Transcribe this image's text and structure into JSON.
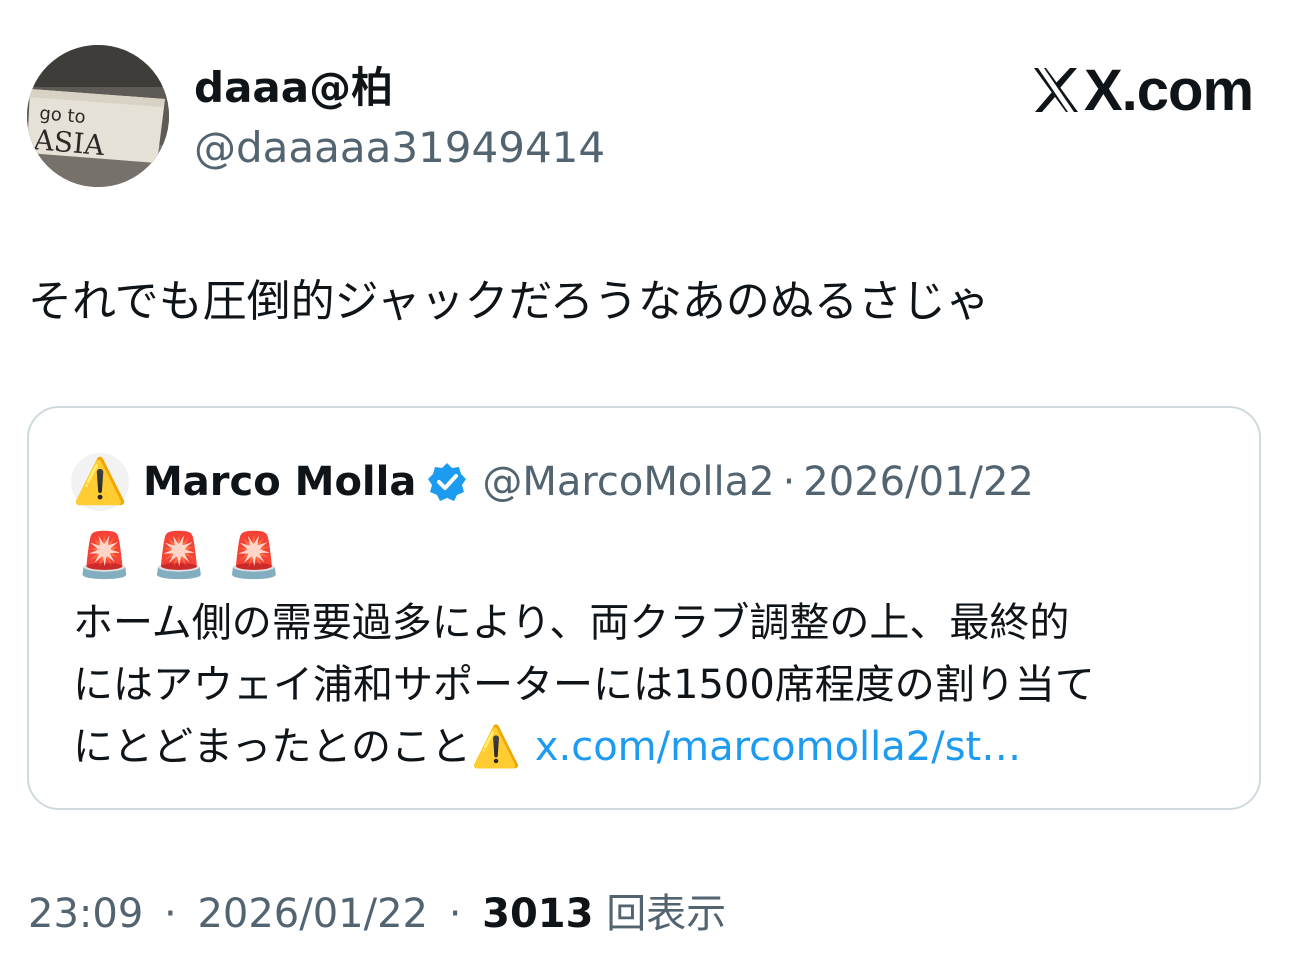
{
  "post": {
    "display_name": "daaa@柏",
    "handle": "@daaaaa31949414",
    "brand": "X.com",
    "avatar_icon": "sign-photo-avatar",
    "avatar_text": "go to ASIA",
    "text": "それでも圧倒的ジャックだろうなあのぬるさじゃ"
  },
  "quote": {
    "author": "Marco Molla",
    "avatar_icon": "warning-icon",
    "verified_icon": "verified-badge-icon",
    "handle": "@MarcoMolla2",
    "separator": "·",
    "date": "2026/01/22",
    "sirens": [
      "🚨",
      "🚨",
      "🚨"
    ],
    "line1": "ホーム側の需要過多により、両クラブ調整の上、最終的",
    "line2": "にはアウェイ浦和サポーターには1500席程度の割り当て",
    "line3": "にとどまったとのこと⚠️",
    "link": "x.com/marcomolla2/st…"
  },
  "meta": {
    "time": "23:09",
    "separator": "·",
    "date": "2026/01/22",
    "views": "3013",
    "views_label": "回表示"
  },
  "colors": {
    "text": "#0f1419",
    "secondary": "#536471",
    "link": "#1d9bf0",
    "border": "#cfd9de"
  }
}
